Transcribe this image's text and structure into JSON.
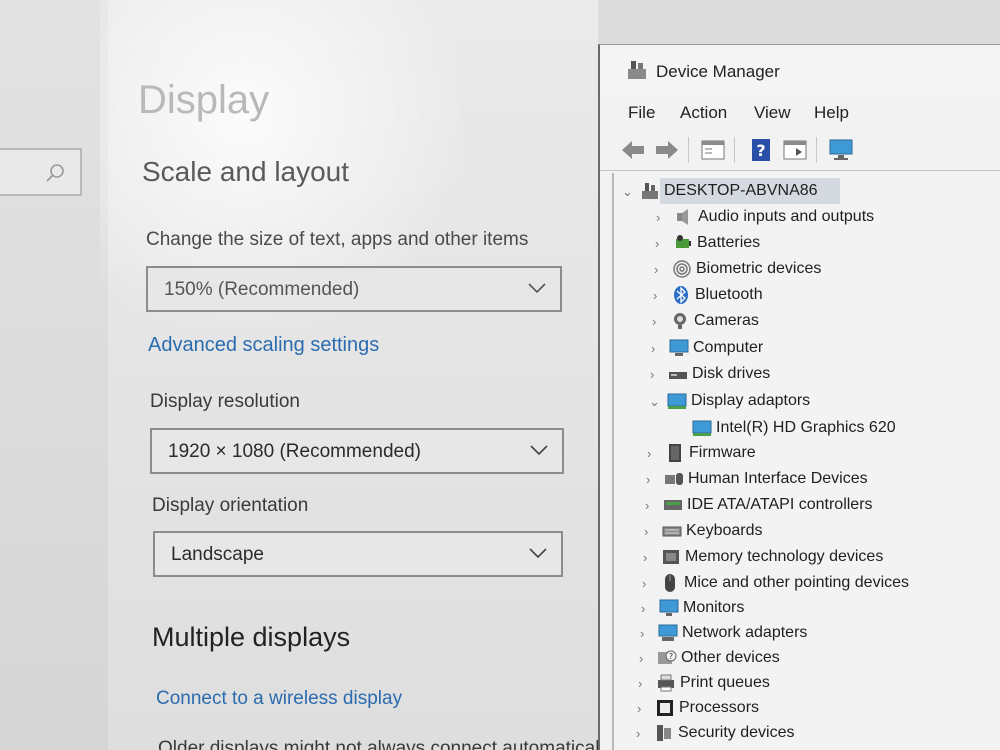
{
  "settings": {
    "page_title": "Display",
    "scale_heading": "Scale and layout",
    "scale_label": "Change the size of text, apps and other items",
    "scale_value": "150% (Recommended)",
    "advanced_link": "Advanced scaling settings",
    "resolution_label": "Display resolution",
    "resolution_value": "1920 × 1080 (Recommended)",
    "orientation_label": "Display orientation",
    "orientation_value": "Landscape",
    "multiple_heading": "Multiple displays",
    "wireless_link": "Connect to a wireless display",
    "cutoff_text": "Older displays might not always connect automatically"
  },
  "device_manager": {
    "title": "Device Manager",
    "menu": [
      "File",
      "Action",
      "View",
      "Help"
    ],
    "toolbar_icons": [
      "back-arrow-icon",
      "forward-arrow-icon",
      "properties-icon",
      "help-icon",
      "view-icon",
      "monitor-icon"
    ],
    "root": "DESKTOP-ABVNA86",
    "nodes": [
      {
        "label": "Audio inputs and outputs",
        "icon": "speaker-icon"
      },
      {
        "label": "Batteries",
        "icon": "battery-icon"
      },
      {
        "label": "Biometric devices",
        "icon": "fingerprint-icon"
      },
      {
        "label": "Bluetooth",
        "icon": "bluetooth-icon"
      },
      {
        "label": "Cameras",
        "icon": "camera-icon"
      },
      {
        "label": "Computer",
        "icon": "computer-icon"
      },
      {
        "label": "Disk drives",
        "icon": "disk-icon"
      },
      {
        "label": "Display adaptors",
        "icon": "display-adapter-icon",
        "expanded": true
      },
      {
        "label": "Intel(R) HD Graphics 620",
        "icon": "display-adapter-icon",
        "child": true
      },
      {
        "label": "Firmware",
        "icon": "chip-icon"
      },
      {
        "label": "Human Interface Devices",
        "icon": "hid-icon"
      },
      {
        "label": "IDE ATA/ATAPI controllers",
        "icon": "ide-icon"
      },
      {
        "label": "Keyboards",
        "icon": "keyboard-icon"
      },
      {
        "label": "Memory technology devices",
        "icon": "memory-icon"
      },
      {
        "label": "Mice and other pointing devices",
        "icon": "mouse-icon"
      },
      {
        "label": "Monitors",
        "icon": "monitor-icon"
      },
      {
        "label": "Network adapters",
        "icon": "network-icon"
      },
      {
        "label": "Other devices",
        "icon": "unknown-device-icon"
      },
      {
        "label": "Print queues",
        "icon": "printer-icon"
      },
      {
        "label": "Processors",
        "icon": "processor-icon"
      },
      {
        "label": "Security devices",
        "icon": "security-icon"
      }
    ]
  }
}
